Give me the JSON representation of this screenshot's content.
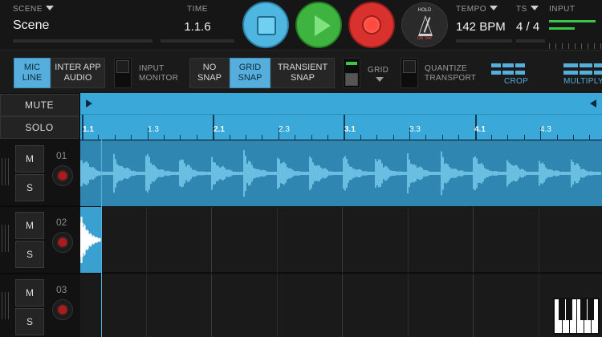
{
  "header": {
    "scene_label": "SCENE",
    "scene_value": "Scene",
    "time_label": "TIME",
    "time_value": "1.1.6",
    "metronome_hold": "HOLD",
    "metronome_tap": "OR TAP",
    "tempo_label": "TEMPO",
    "tempo_value": "142 BPM",
    "ts_label": "TS",
    "ts_value": "4 / 4",
    "input_label": "INPUT"
  },
  "toolbar": {
    "mic_line": "MIC\nLINE",
    "inter_app_audio": "INTER APP\nAUDIO",
    "input_monitor": "INPUT\nMONITOR",
    "no_snap": "NO\nSNAP",
    "grid_snap": "GRID\nSNAP",
    "transient_snap": "TRANSIENT\nSNAP",
    "grid_label": "GRID",
    "quantize_transport": "QUANTIZE\nTRANSPORT",
    "crop": "CROP",
    "multiply": "MULTIPLY"
  },
  "tracks_panel": {
    "mute": "MUTE",
    "solo": "SOLO"
  },
  "ruler": {
    "labels": [
      "1.1",
      "1.3",
      "2.1",
      "2.3",
      "3.1",
      "3.3",
      "4.1",
      "4.3"
    ]
  },
  "tracks": [
    {
      "number": "01",
      "mute": "M",
      "solo": "S"
    },
    {
      "number": "02",
      "mute": "M",
      "solo": "S"
    },
    {
      "number": "03",
      "mute": "M",
      "solo": "S"
    }
  ],
  "colors": {
    "accent": "#55aedb",
    "play": "#3fb33f",
    "record": "#d9322e",
    "meter": "#39c64a"
  }
}
